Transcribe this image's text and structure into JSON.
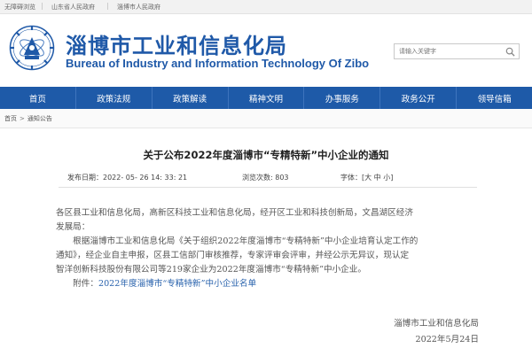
{
  "topbar": {
    "links": [
      "无障碍浏览",
      "山东省人民政府",
      "淄博市人民政府"
    ]
  },
  "header": {
    "title": "淄博市工业和信息化局",
    "subtitle": "Bureau of Industry and Information Technology Of Zibo",
    "brand_color": "#1f59a8"
  },
  "search": {
    "placeholder": "请输入关键字"
  },
  "nav": {
    "color": "#1e5aa8",
    "items": [
      "首页",
      "政策法规",
      "政策解读",
      "精神文明",
      "办事服务",
      "政务公开",
      "领导信箱"
    ]
  },
  "breadcrumb": {
    "items": [
      "首页",
      "通知公告"
    ],
    "separator": ">"
  },
  "article": {
    "title": "关于公布2022年度淄博市“专精特新”中小企业的通知",
    "meta": {
      "published": "发布日期：2022- 05- 26 14: 33: 21",
      "views": "浏览次数: 803",
      "font_label": "字体：[",
      "font_large": "大",
      "font_medium": "中",
      "font_small": "小",
      "font_end": "]"
    },
    "paragraphs": [
      "各区县工业和信息化局，高新区科技工业和信息化局，经开区工业和科技创新局，文昌湖区经济",
      "发展局：",
      "　　根据淄博市工业和信息化局《关于组织2022年度淄博市“专精特新”中小企业培育认定工作的",
      "通知》，经企业自主申报，区县工信部门审核推荐，专家评审会评审，并经公示无异议，现认定",
      "智洋创新科技股份有限公司等219家企业为2022年度淄博市“专精特新”中小企业。"
    ],
    "attachment_label": "　　附件：",
    "attachment_link": "2022年度淄博市“专精特新”中小企业名单",
    "signature": "淄博市工业和信息化局",
    "date": "2022年5月24日"
  }
}
